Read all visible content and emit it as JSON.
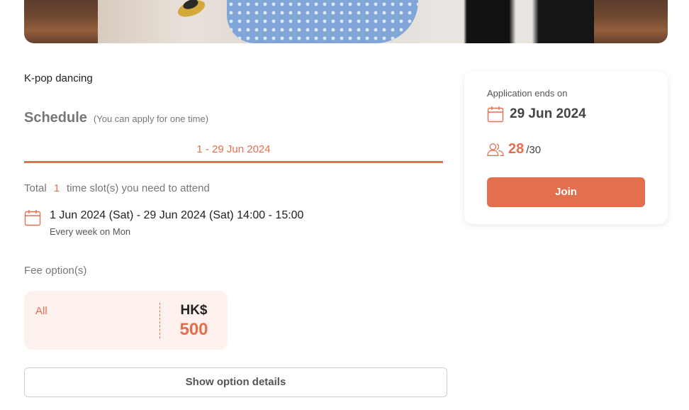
{
  "activity": {
    "title": "K-pop dancing"
  },
  "schedule": {
    "heading": "Schedule",
    "note": "(You can apply for one time)",
    "tab_label": "1 - 29 Jun 2024",
    "total_prefix": "Total",
    "total_count": "1",
    "total_suffix": "time slot(s) you need to attend",
    "session": {
      "dates": "1 Jun 2024 (Sat) - 29 Jun 2024 (Sat) 14:00 - 15:00",
      "recurrence": "Every week on Mon"
    }
  },
  "fees": {
    "label": "Fee option(s)",
    "options": [
      {
        "name": "All",
        "currency": "HK$",
        "amount": "500"
      }
    ],
    "details_button": "Show option details"
  },
  "apply": {
    "ends_label": "Application ends on",
    "ends_date": "29 Jun 2024",
    "enrolled": "28",
    "capacity": "/30",
    "join_button": "Join"
  },
  "colors": {
    "accent": "#e46f4f",
    "fee_card_bg": "#fdf1ed",
    "muted_text": "#777777"
  },
  "icons": {
    "calendar": "calendar-icon",
    "people": "people-icon"
  }
}
